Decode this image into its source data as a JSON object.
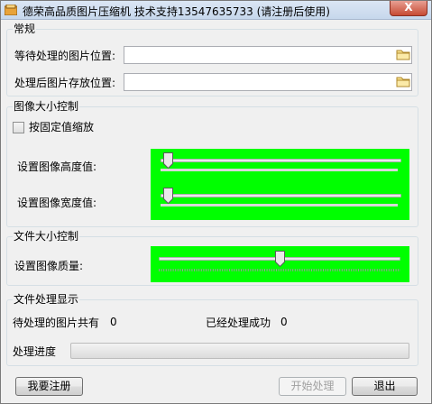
{
  "window": {
    "title": "德荣高品质图片压缩机  技术支持13547635733 (请注册后使用)",
    "close_glyph": "X"
  },
  "general": {
    "title": "常规",
    "source_label": "等待处理的图片位置:",
    "source_value": "",
    "dest_label": "处理后图片存放位置:",
    "dest_value": ""
  },
  "size_control": {
    "title": "图像大小控制",
    "fixed_ratio_label": "按固定值缩放",
    "fixed_ratio_checked": false,
    "height_label": "设置图像高度值:",
    "height_slider": 0,
    "width_label": "设置图像宽度值:",
    "width_slider": 0
  },
  "filesize_control": {
    "title": "文件大小控制",
    "quality_label": "设置图像质量:",
    "quality_slider": 0.5
  },
  "file_display": {
    "title": "文件处理显示",
    "pending_label": "待处理的图片共有",
    "pending_count": "0",
    "done_label": "已经处理成功",
    "done_count": "0",
    "progress_label": "处理进度",
    "progress": 0
  },
  "buttons": {
    "register": "我要注册",
    "start": "开始处理",
    "exit": "退出"
  },
  "colors": {
    "slider_panel": "#00ff00"
  }
}
